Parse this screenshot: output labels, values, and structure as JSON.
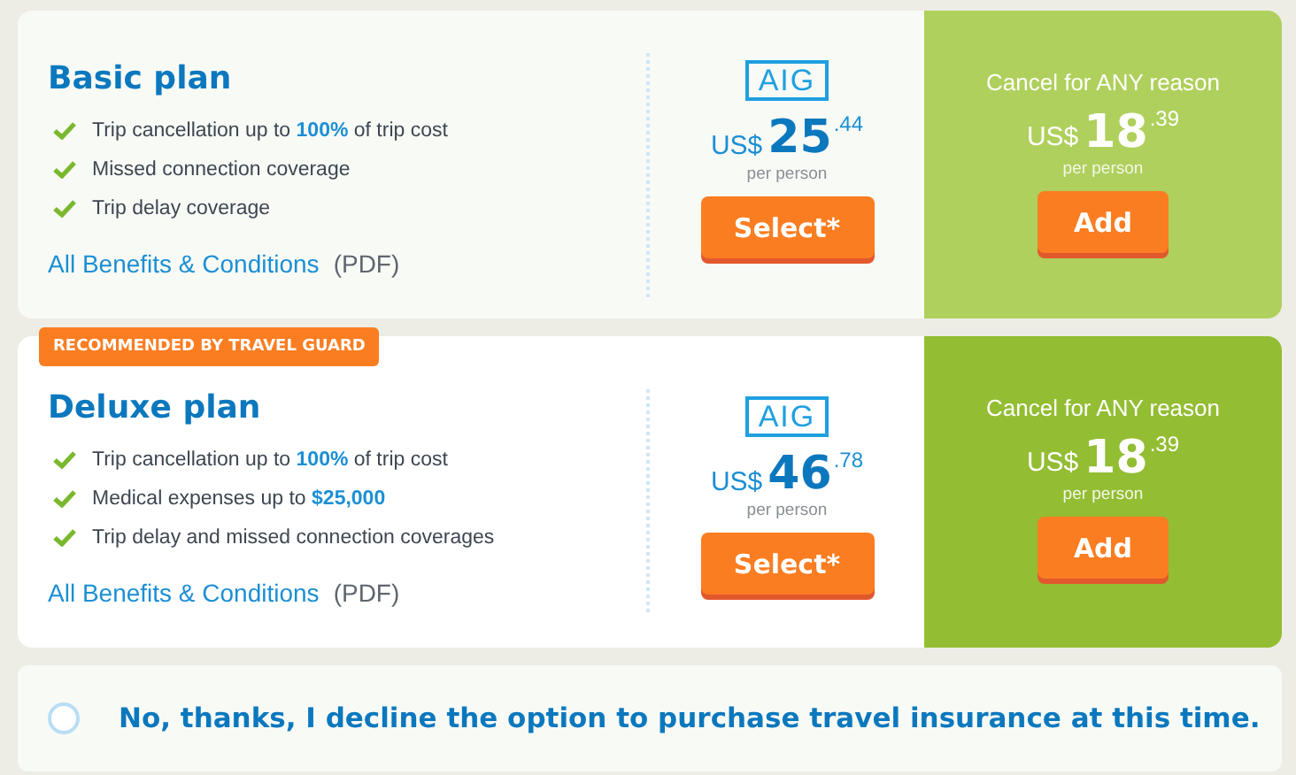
{
  "plans": [
    {
      "name": "Basic plan",
      "recommended": false,
      "features": [
        "Trip cancellation up to **100%** of trip cost",
        "Missed connection coverage",
        "Trip delay coverage"
      ],
      "benefits_link": "All Benefits & Conditions",
      "benefits_note": "(PDF)",
      "logo": "AIG",
      "price": {
        "currency": "US$",
        "whole": "25",
        "cents": ".44",
        "unit": "per person"
      },
      "select_button": "Select*",
      "addon": {
        "title": "Cancel for ANY reason",
        "price": {
          "currency": "US$",
          "whole": "18",
          "cents": ".39",
          "unit": "per person"
        },
        "button": "Add"
      }
    },
    {
      "name": "Deluxe plan",
      "recommended": true,
      "badge": "RECOMMENDED BY TRAVEL GUARD",
      "features": [
        "Trip cancellation up to **100%** of trip cost",
        "Medical expenses up to **$25,000**",
        "Trip delay and missed connection coverages"
      ],
      "benefits_link": "All Benefits & Conditions",
      "benefits_note": "(PDF)",
      "logo": "AIG",
      "price": {
        "currency": "US$",
        "whole": "46",
        "cents": ".78",
        "unit": "per person"
      },
      "select_button": "Select*",
      "addon": {
        "title": "Cancel for ANY reason",
        "price": {
          "currency": "US$",
          "whole": "18",
          "cents": ".39",
          "unit": "per person"
        },
        "button": "Add"
      }
    }
  ],
  "decline": {
    "label": "No, thanks, I decline the option to purchase travel insurance at this time.",
    "selected": false
  }
}
